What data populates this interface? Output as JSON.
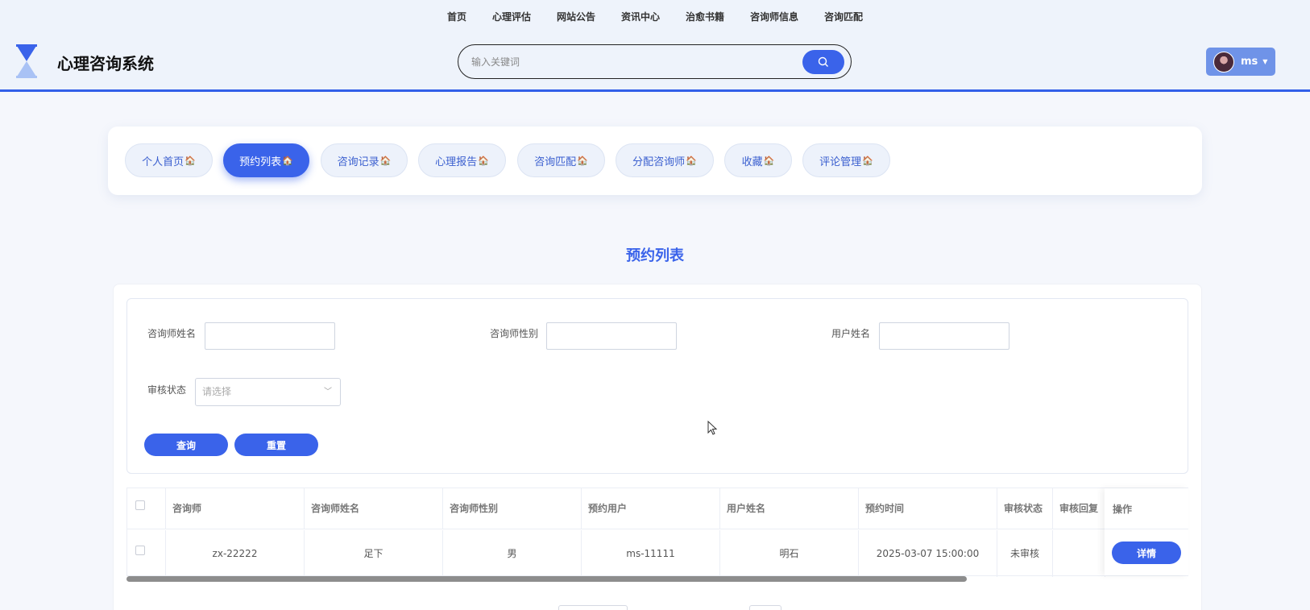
{
  "top_nav": [
    "首页",
    "心理评估",
    "网站公告",
    "资讯中心",
    "治愈书籍",
    "咨询师信息",
    "咨询匹配"
  ],
  "site": {
    "title": "心理咨询系统"
  },
  "search": {
    "placeholder": "输入关键词"
  },
  "user": {
    "name": "ms"
  },
  "tabs": [
    {
      "label": "个人首页",
      "active": false
    },
    {
      "label": "预约列表",
      "active": true
    },
    {
      "label": "咨询记录",
      "active": false
    },
    {
      "label": "心理报告",
      "active": false
    },
    {
      "label": "咨询匹配",
      "active": false
    },
    {
      "label": "分配咨询师",
      "active": false
    },
    {
      "label": "收藏",
      "active": false
    },
    {
      "label": "评论管理",
      "active": false
    }
  ],
  "page_title": "预约列表",
  "filters": {
    "counselor_name_label": "咨询师姓名",
    "counselor_gender_label": "咨询师性别",
    "user_name_label": "用户姓名",
    "status_label": "审核状态",
    "status_placeholder": "请选择",
    "query_button": "查询",
    "reset_button": "重置"
  },
  "table": {
    "columns": [
      "咨询师",
      "咨询师姓名",
      "咨询师性别",
      "预约用户",
      "用户姓名",
      "预约时间",
      "审核状态",
      "审核回复",
      "操作"
    ],
    "rows": [
      {
        "cells": [
          "zx-22222",
          "足下",
          "男",
          "ms-11111",
          "明石",
          "2025-03-07 15:00:00",
          "未审核",
          ""
        ],
        "action": "详情"
      }
    ]
  },
  "colors": {
    "accent": "#3a63ea",
    "header_bg": "#eef3fb"
  }
}
